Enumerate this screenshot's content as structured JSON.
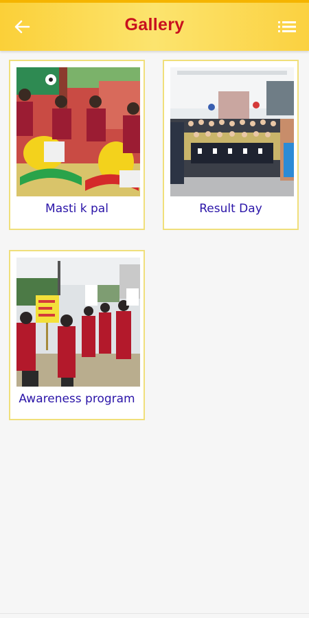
{
  "header": {
    "title": "Gallery",
    "back_icon": "arrow-left-icon",
    "menu_icon": "list-menu-icon",
    "background": "#fbd038",
    "title_color": "#c8101e"
  },
  "gallery": {
    "label_color": "#2a14a8",
    "albums": [
      {
        "label": "Masti k pal",
        "photo": "children-on-rocking-horses"
      },
      {
        "label": "Result Day",
        "photo": "group-photo-students-staff"
      },
      {
        "label": "Awareness program",
        "photo": "students-rally-with-placards"
      }
    ]
  }
}
